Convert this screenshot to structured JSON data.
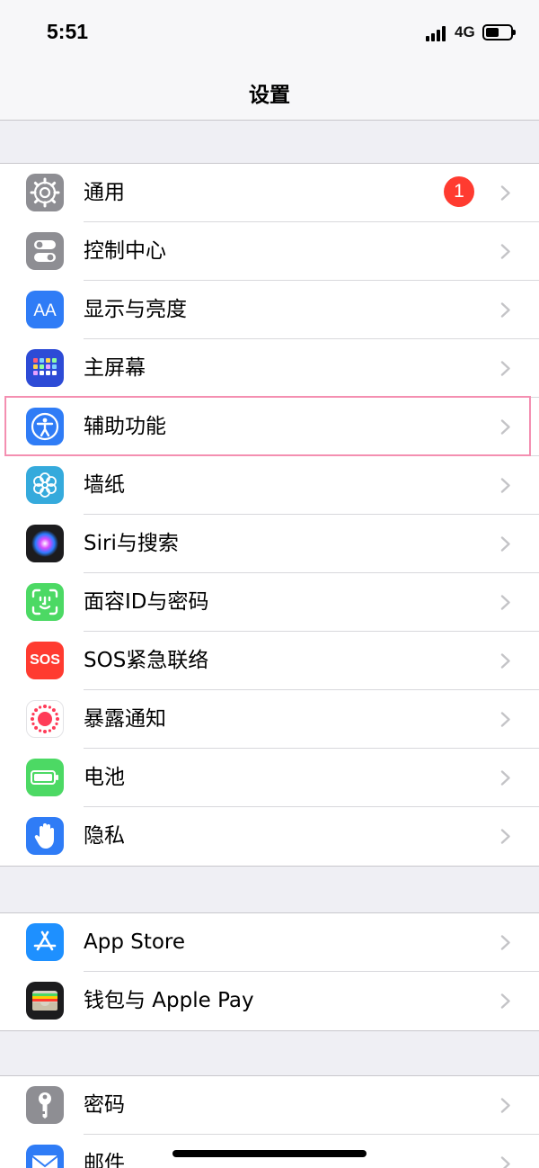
{
  "status_bar": {
    "time": "5:51",
    "network": "4G"
  },
  "nav": {
    "title": "设置"
  },
  "badge": {
    "general_count": "1"
  },
  "groups": [
    {
      "items": [
        {
          "label": "通用",
          "icon": "gear-icon",
          "color": "#8e8e93"
        },
        {
          "label": "控制中心",
          "icon": "switches-icon",
          "color": "#8e8e93"
        },
        {
          "label": "显示与亮度",
          "icon": "aa-icon",
          "color": "#2f7cf6"
        },
        {
          "label": "主屏幕",
          "icon": "home-grid-icon",
          "color": "#2d4bd6"
        },
        {
          "label": "辅助功能",
          "icon": "accessibility-icon",
          "color": "#2f7cf6"
        },
        {
          "label": "墙纸",
          "icon": "flower-icon",
          "color": "#35aadc"
        },
        {
          "label": "Siri与搜索",
          "icon": "siri-icon",
          "color": "#1c1c1e"
        },
        {
          "label": "面容ID与密码",
          "icon": "face-id-icon",
          "color": "#4cd964"
        },
        {
          "label": "SOS紧急联络",
          "icon": "sos-icon",
          "color": "#ff3b30"
        },
        {
          "label": "暴露通知",
          "icon": "exposure-icon",
          "color": "#ffffff"
        },
        {
          "label": "电池",
          "icon": "battery-icon",
          "color": "#4cd964"
        },
        {
          "label": "隐私",
          "icon": "hand-icon",
          "color": "#2f7cf6"
        }
      ]
    },
    {
      "items": [
        {
          "label": "App Store",
          "icon": "app-store-icon",
          "color": "#1e90ff"
        },
        {
          "label": "钱包与 Apple Pay",
          "icon": "wallet-icon",
          "color": "#1c1c1e"
        }
      ]
    },
    {
      "items": [
        {
          "label": "密码",
          "icon": "key-icon",
          "color": "#8e8e93"
        },
        {
          "label": "邮件",
          "icon": "mail-icon",
          "color": "#2f7cf6"
        }
      ]
    }
  ],
  "sos_text": "SOS"
}
